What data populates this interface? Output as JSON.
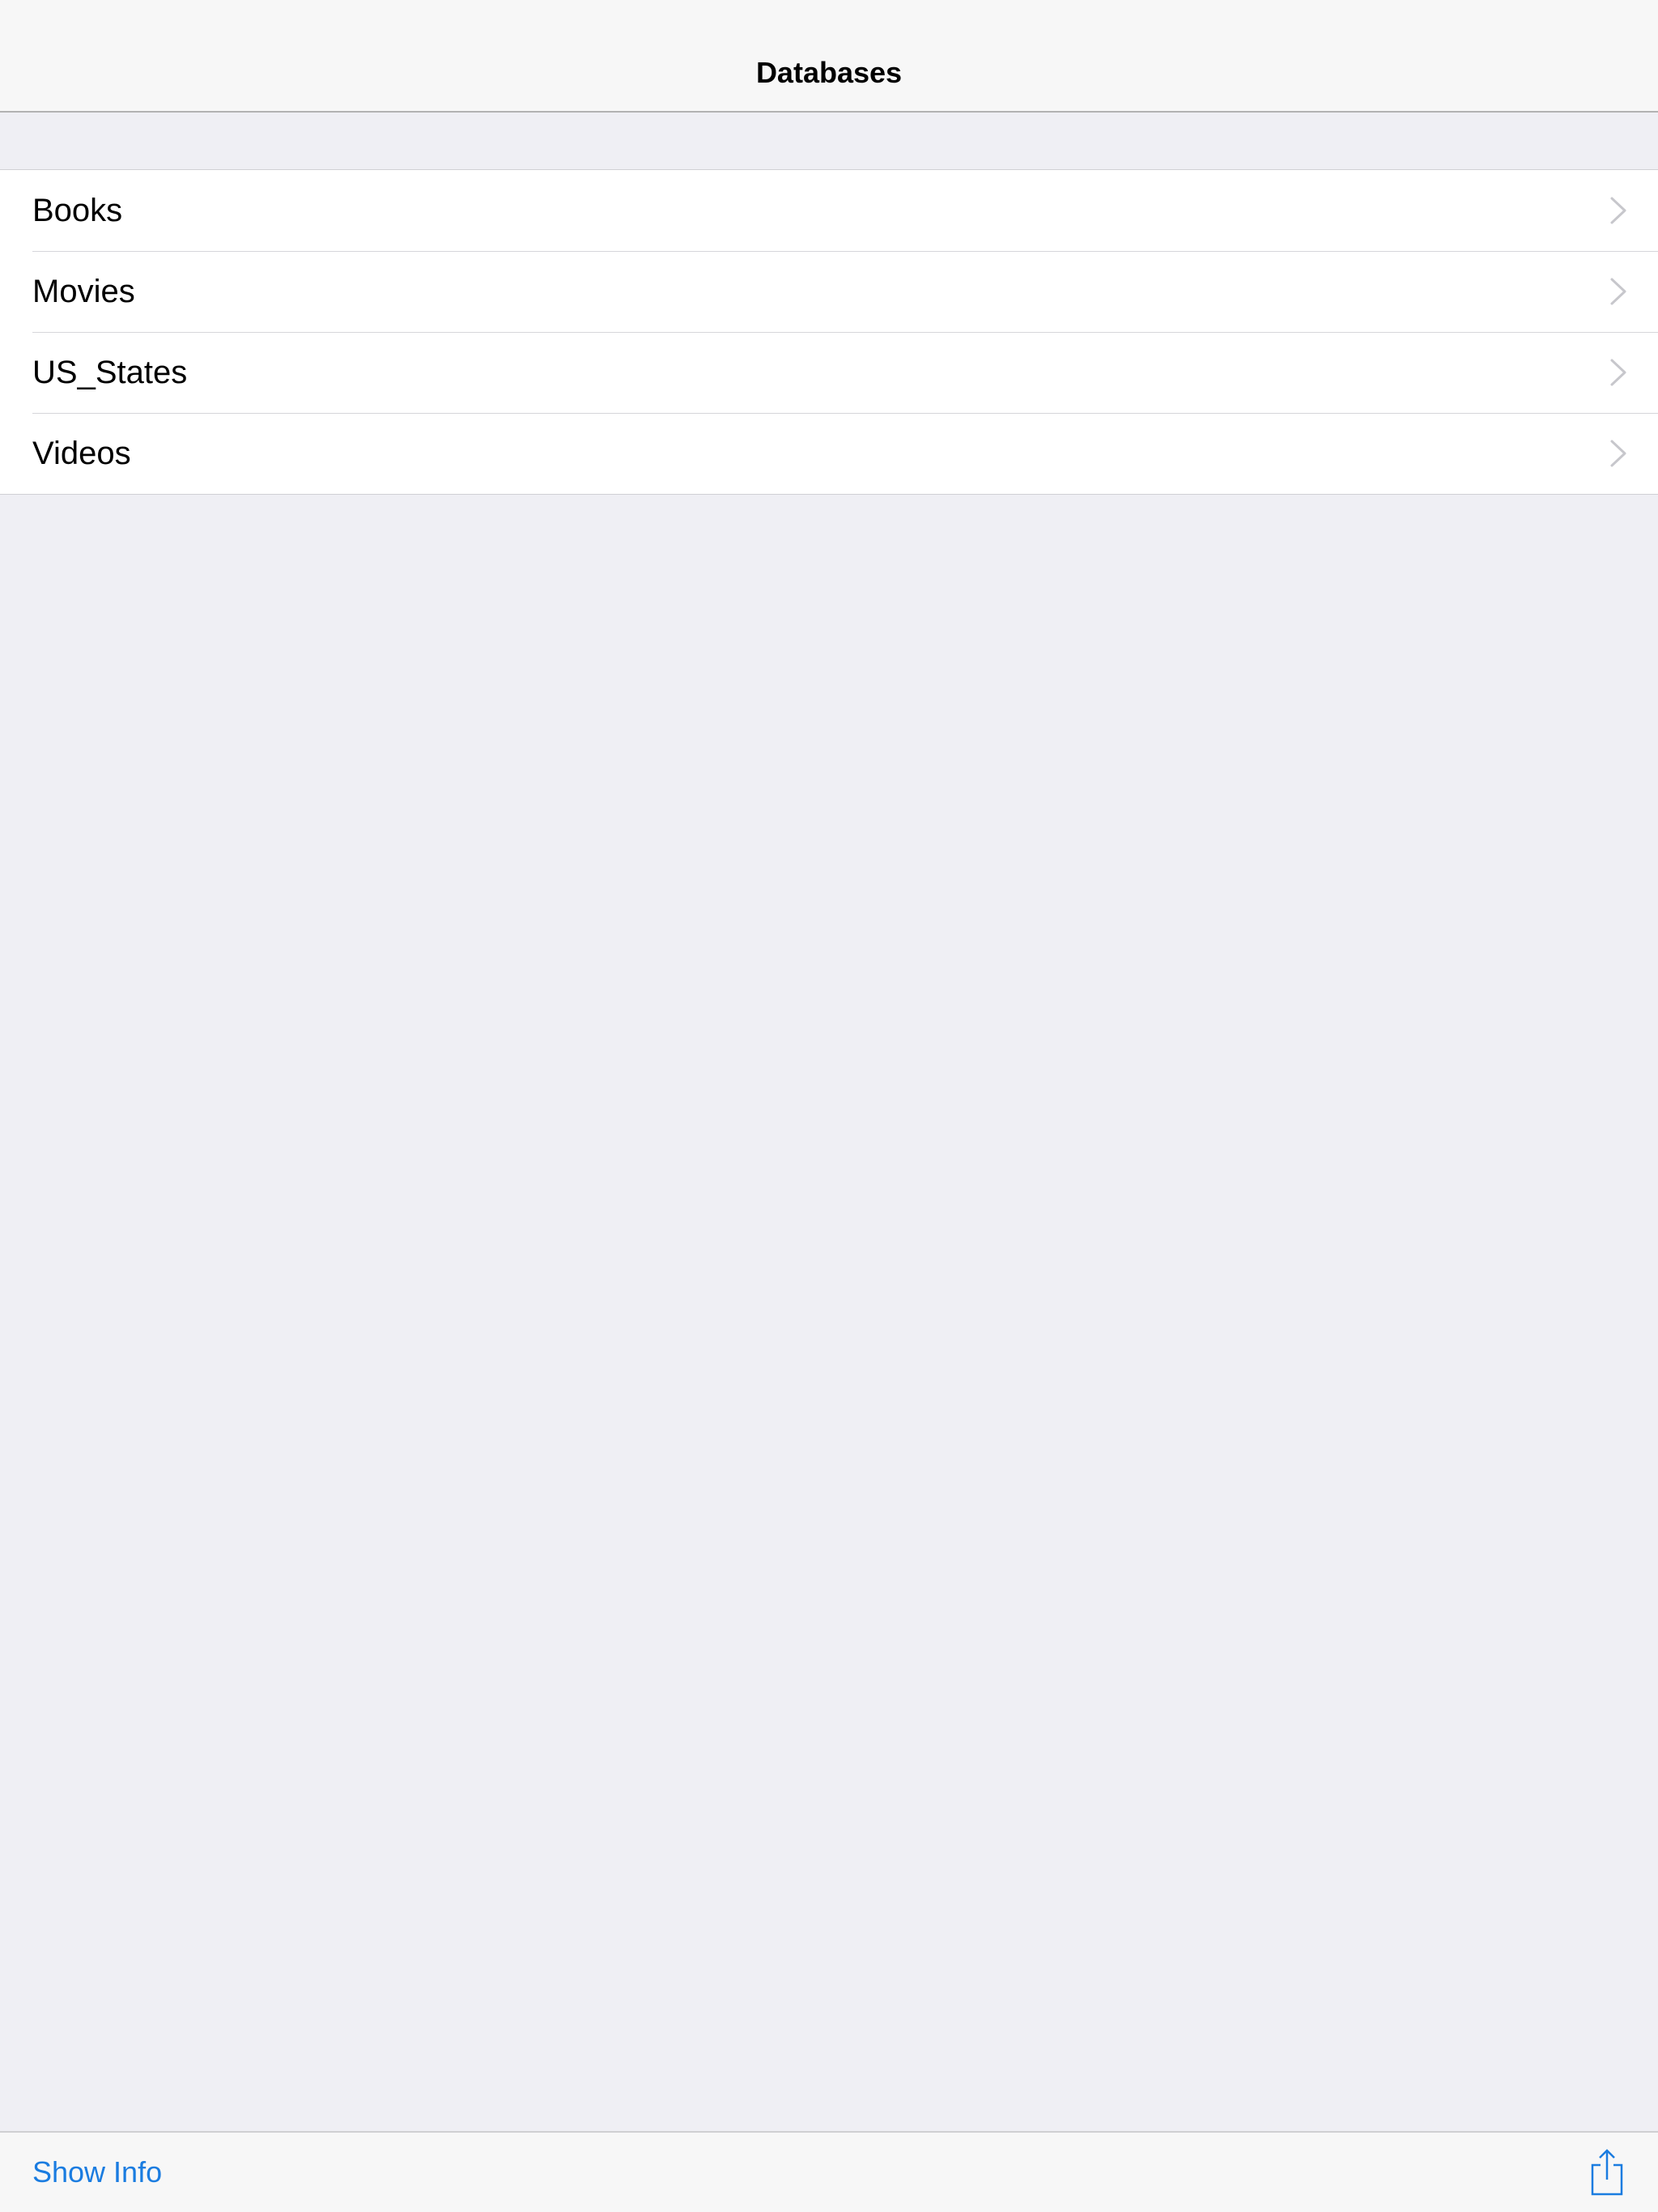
{
  "navbar": {
    "title": "Databases"
  },
  "databases": [
    {
      "label": "Books"
    },
    {
      "label": "Movies"
    },
    {
      "label": "US_States"
    },
    {
      "label": "Videos"
    }
  ],
  "toolbar": {
    "show_info_label": "Show Info",
    "share_icon": "share-icon"
  },
  "colors": {
    "accent": "#1a7ce0",
    "background": "#efeff4",
    "chevron": "#c7c7cc"
  }
}
